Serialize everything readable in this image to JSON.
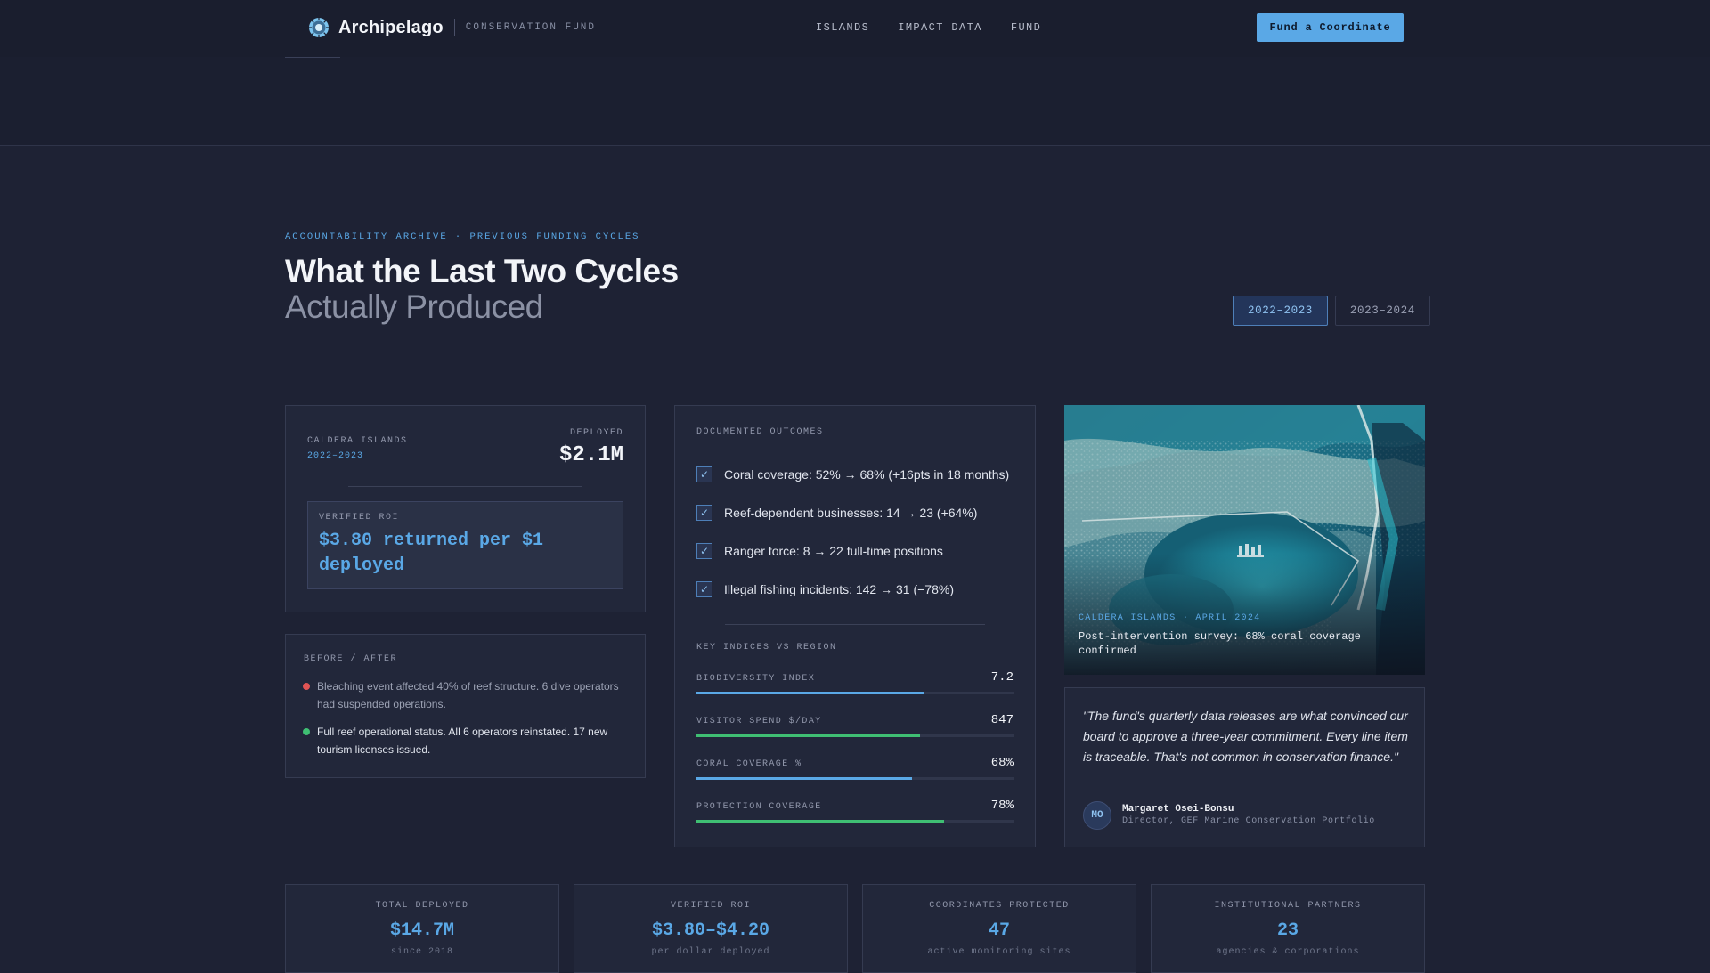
{
  "header": {
    "brand": "Archipelago",
    "brand_sub": "CONSERVATION FUND",
    "nav": [
      "ISLANDS",
      "IMPACT DATA",
      "FUND"
    ],
    "cta": "Fund a Coordinate"
  },
  "section": {
    "eyebrow": "ACCOUNTABILITY ARCHIVE · PREVIOUS FUNDING CYCLES",
    "title_line1": "What the Last Two Cycles",
    "title_line2": "Actually Produced",
    "tabs": [
      {
        "label": "2022–2023",
        "active": true
      },
      {
        "label": "2023–2024",
        "active": false
      }
    ]
  },
  "summary_card": {
    "island": "CALDERA ISLANDS",
    "cycle": "2022–2023",
    "deployed_label": "DEPLOYED",
    "deployed_value": "$2.1M",
    "roi_label": "VERIFIED ROI",
    "roi_text": "$3.80 returned per $1 deployed"
  },
  "before_after": {
    "label": "BEFORE / AFTER",
    "before": "Bleaching event affected 40% of reef structure. 6 dive operators had suspended operations.",
    "after": "Full reef operational status. All 6 operators reinstated. 17 new tourism licenses issued.",
    "colors": {
      "before": "#e05454",
      "after": "#3fbf73"
    }
  },
  "outcomes": {
    "label": "DOCUMENTED OUTCOMES",
    "items": [
      "Coral coverage: 52% → 68% (+16pts in 18 months)",
      "Reef-dependent businesses: 14 → 23 (+64%)",
      "Ranger force: 8 → 22 full-time positions",
      "Illegal fishing incidents: 142 → 31 (−78%)"
    ],
    "indices_label": "KEY INDICES VS REGION",
    "metrics": [
      {
        "label": "BIODIVERSITY INDEX",
        "value": "7.2",
        "fill": 0.72,
        "color": "#5aa8e6"
      },
      {
        "label": "VISITOR SPEND $/DAY",
        "value": "847",
        "fill": 0.705,
        "color": "#3fbf73"
      },
      {
        "label": "CORAL COVERAGE %",
        "value": "68%",
        "fill": 0.68,
        "color": "#5aa8e6"
      },
      {
        "label": "PROTECTION COVERAGE",
        "value": "78%",
        "fill": 0.78,
        "color": "#3fbf73"
      }
    ]
  },
  "image_card": {
    "tag": "CALDERA ISLANDS · APRIL 2024",
    "caption": "Post-intervention survey: 68% coral coverage confirmed"
  },
  "quote": {
    "text": "\"The fund's quarterly data releases are what convinced our board to approve a three-year commitment. Every line item is traceable. That's not common in conservation finance.\"",
    "initials": "MO",
    "name": "Margaret Osei-Bonsu",
    "role": "Director, GEF Marine Conservation Portfolio"
  },
  "stats": [
    {
      "label": "TOTAL DEPLOYED",
      "value": "$14.7M",
      "sub": "since 2018"
    },
    {
      "label": "VERIFIED ROI",
      "value": "$3.80–$4.20",
      "sub": "per dollar deployed"
    },
    {
      "label": "COORDINATES PROTECTED",
      "value": "47",
      "sub": "active monitoring sites"
    },
    {
      "label": "INSTITUTIONAL PARTNERS",
      "value": "23",
      "sub": "agencies & corporations"
    }
  ]
}
